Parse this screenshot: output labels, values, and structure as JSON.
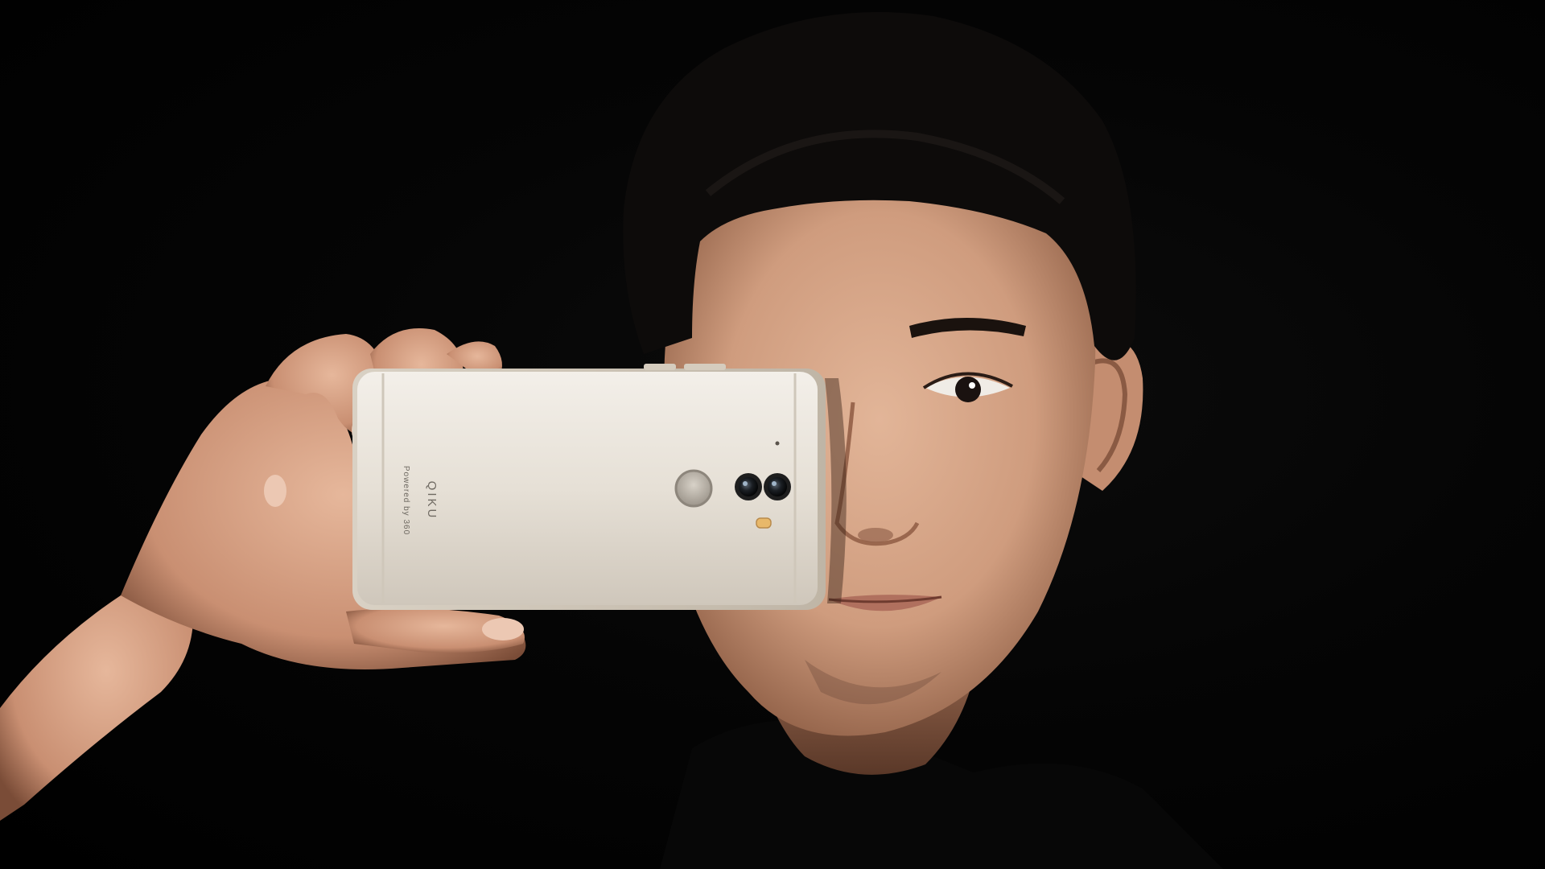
{
  "photo": {
    "background_color": "#020202",
    "skin_color": "#d9a98c",
    "hair_color": "#0d0b0a",
    "shirt_color": "#080808",
    "phone_color": "#e9e3da"
  },
  "phone": {
    "brand": "QIKU",
    "tagline": "Powered by 360"
  }
}
